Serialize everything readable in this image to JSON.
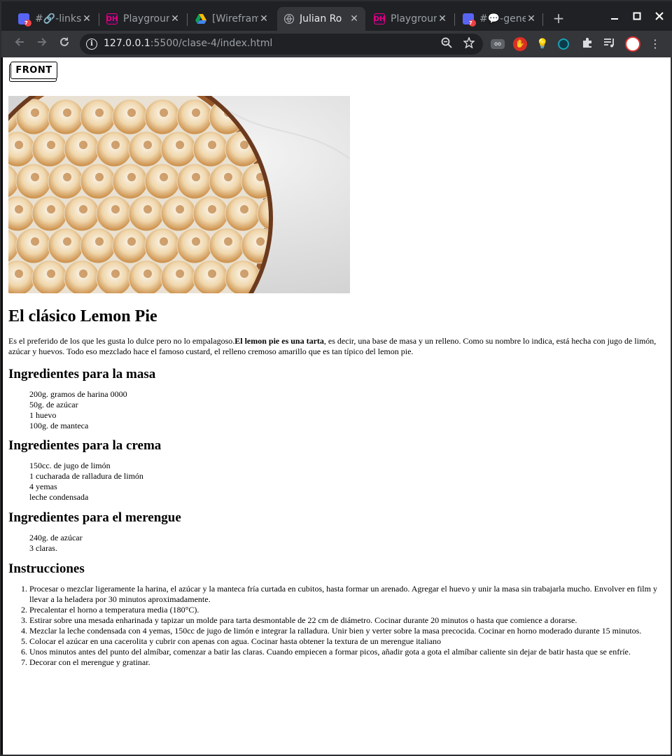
{
  "browser": {
    "tabs": [
      {
        "title": "#🔗-links",
        "icon": "discord-icon",
        "active": false
      },
      {
        "title": "Playground",
        "icon": "dh-icon",
        "active": false
      },
      {
        "title": "[Wireframe]",
        "icon": "google-drive-icon",
        "active": false
      },
      {
        "title": "Julian Ro",
        "icon": "globe-icon",
        "active": true
      },
      {
        "title": "Playground",
        "icon": "dh-icon",
        "active": false
      },
      {
        "title": "#💬-general",
        "icon": "discord-icon",
        "active": false
      }
    ],
    "close_glyph": "✕",
    "new_tab_glyph": "+",
    "address": {
      "host": "127.0.0.1",
      "path": ":5500/clase-4/index.html"
    }
  },
  "page": {
    "logo_text": "FRONT",
    "title": "El clásico Lemon Pie",
    "intro": {
      "before": "Es el preferido de los que les gusta lo dulce pero no lo empalagoso.",
      "bold": "El lemon pie es una tarta",
      "after": ", es decir, una base de masa y un relleno. Como su nombre lo indica, está hecha con jugo de limón, azúcar y huevos. Todo eso mezclado hace el famoso custard, el relleno cremoso amarillo que es tan típico del lemon pie."
    },
    "sections": [
      {
        "heading": "Ingredientes para la masa",
        "items": [
          "200g. gramos de harina 0000",
          "50g. de azúcar",
          "1 huevo",
          "100g. de manteca"
        ]
      },
      {
        "heading": "Ingredientes para la crema",
        "items": [
          "150cc. de jugo de limón",
          "1 cucharada de ralladura de limón",
          "4 yemas",
          "leche condensada"
        ]
      },
      {
        "heading": "Ingredientes para el merengue",
        "items": [
          "240g. de azúcar",
          "3 claras."
        ]
      }
    ],
    "instructions_heading": "Instrucciones",
    "instructions": [
      "Procesar o mezclar ligeramente la harina, el azúcar y la manteca fría curtada en cubitos, hasta formar un arenado. Agregar el huevo y unir la masa sin trabajarla mucho. Envolver en film y llevar a la heladera por 30 minutos aproximadamente.",
      "Precalentar el horno a temperatura media (180°C).",
      "Estirar sobre una mesada enharinada y tapizar un molde para tarta desmontable de 22 cm de diámetro. Cocinar durante 20 minutos o hasta que comience a dorarse.",
      "Mezclar la leche condensada con 4 yemas, 150cc de jugo de limón e integrar la ralladura. Unir bien y verter sobre la masa precocida. Cocinar en horno moderado durante 15 minutos.",
      "Colocar el azúcar en una cacerolita y cubrir con apenas con agua. Cocinar hasta obtener la textura de un merengue italiano",
      "Unos minutos antes del punto del almíbar, comenzar a batir las claras. Cuando empiecen a formar picos, añadir gota a gota el almíbar caliente sin dejar de batir hasta que se enfríe.",
      "Decorar con el merengue y gratinar."
    ]
  }
}
